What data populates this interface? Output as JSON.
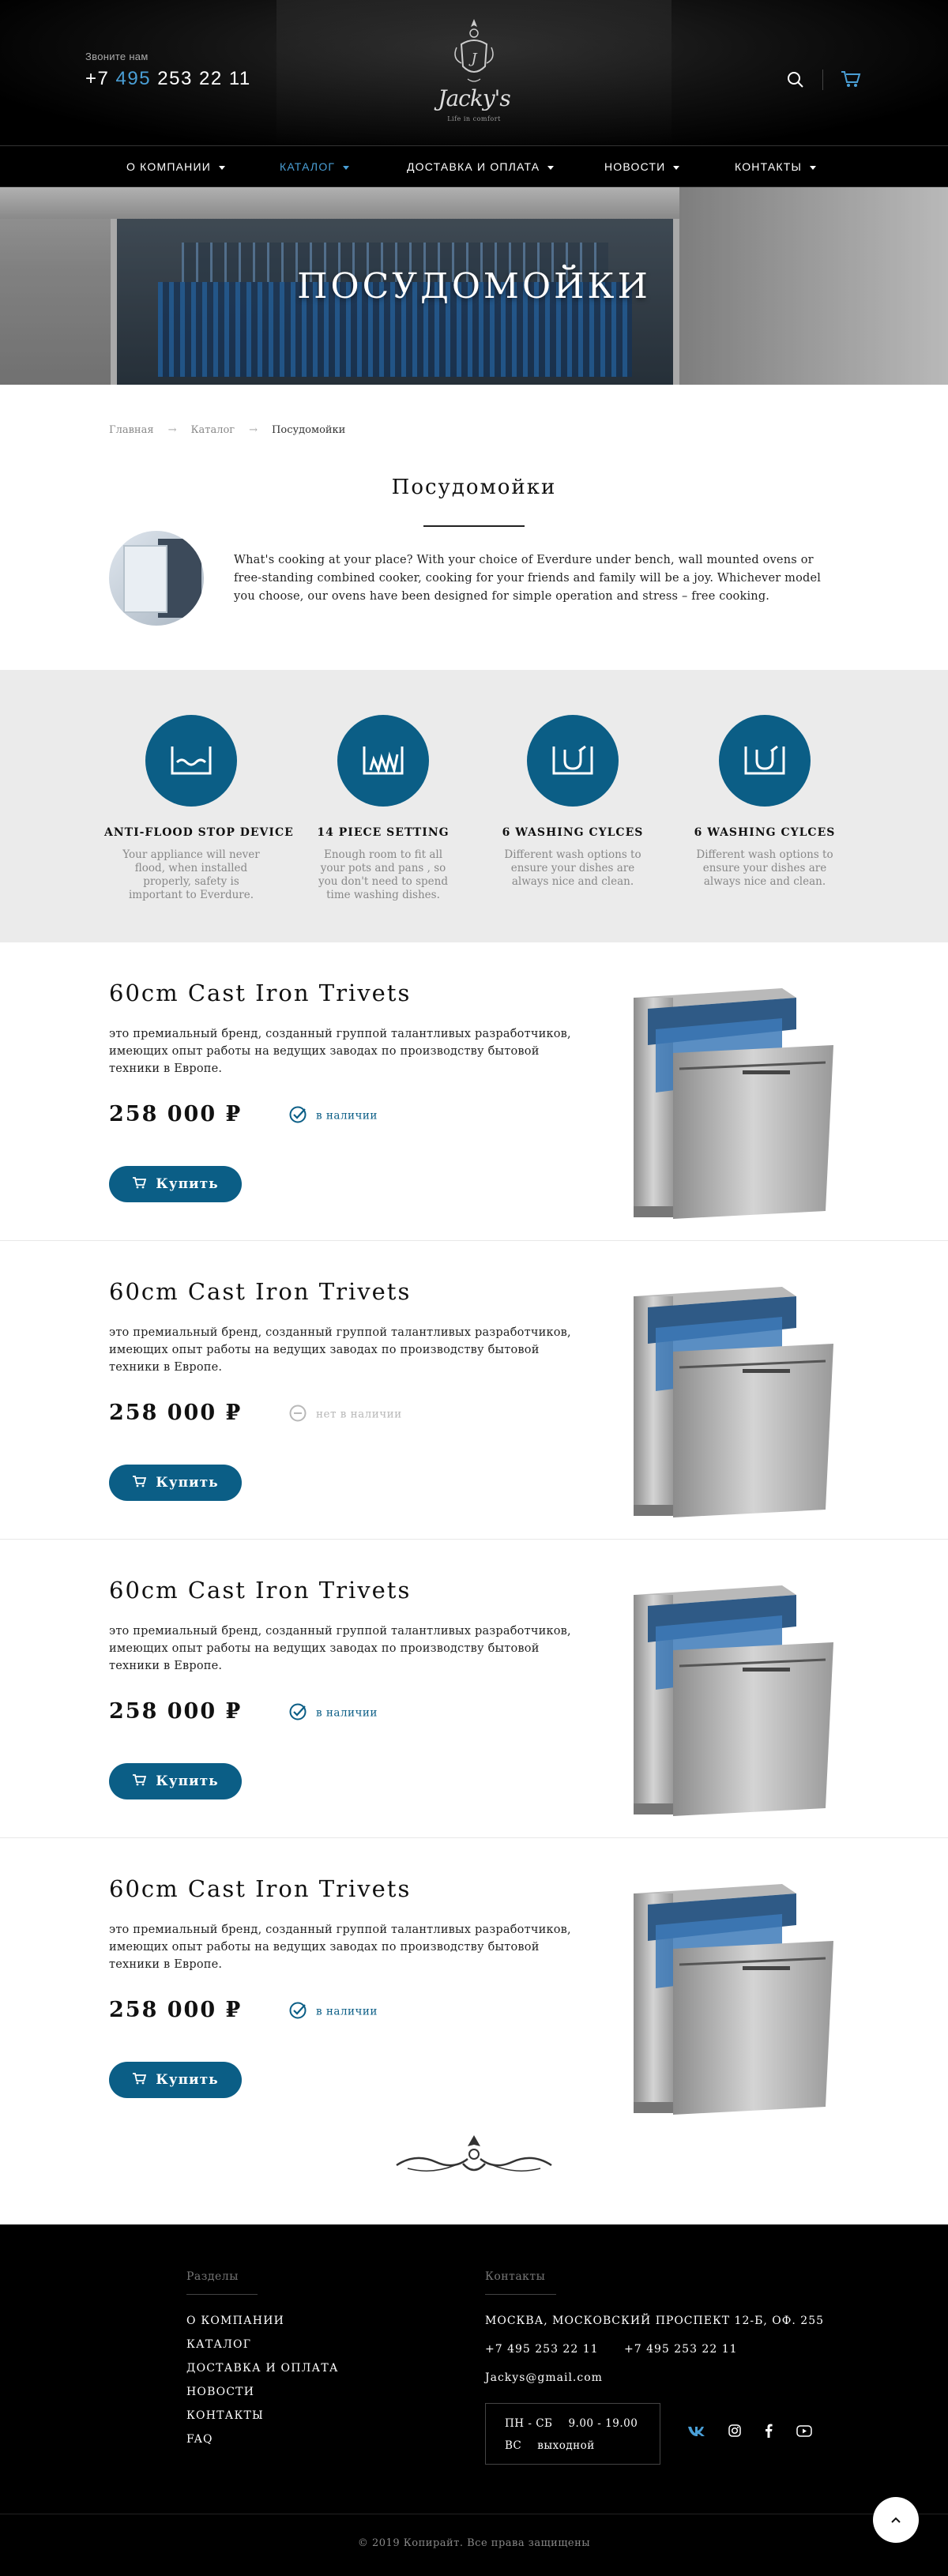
{
  "header": {
    "call_label": "Звоните нам",
    "phone_prefix": "+7",
    "phone_code": "495",
    "phone_number": "253 22 11",
    "logo_brand": "Jacky's",
    "logo_tag": "Life in comfort"
  },
  "nav": [
    {
      "label": "О КОМПАНИИ",
      "active": false
    },
    {
      "label": "КАТАЛОГ",
      "active": true
    },
    {
      "label": "ДОСТАВКА И ОПЛАТА",
      "active": false
    },
    {
      "label": "НОВОСТИ",
      "active": false
    },
    {
      "label": "КОНТАКТЫ",
      "active": false
    }
  ],
  "hero": {
    "title": "ПОСУДОМОЙКИ"
  },
  "breadcrumb": {
    "home": "Главная",
    "catalog": "Каталог",
    "current": "Посудомойки",
    "sep": "→"
  },
  "page": {
    "title": "Посудомойки",
    "intro": "What's cooking at your place? With your choice of Everdure under bench, wall mounted ovens or free-standing combined cooker, cooking for your friends and family will be a joy. Whichever model you choose, our ovens have been designed for simple operation and stress – free cooking."
  },
  "features": [
    {
      "icon": "flood-stop-icon",
      "title": "ANTI-FLOOD STOP DEVICE",
      "desc": "Your appliance will never flood, when installed properly, safety is important to Everdure."
    },
    {
      "icon": "piece-setting-icon",
      "title": "14 PIECE SETTING",
      "desc": "Enough room to fit all your pots and pans , so you don't need to spend time washing dishes."
    },
    {
      "icon": "washing-cycle-icon",
      "title": "6 WASHING CYLCES",
      "desc": "Different wash options to ensure your dishes are always nice and clean."
    },
    {
      "icon": "washing-cycle-icon",
      "title": "6 WASHING CYLCES",
      "desc": "Different wash options to ensure your dishes are always nice and clean."
    }
  ],
  "products": [
    {
      "name": "60cm Cast Iron Trivets",
      "desc": "это премиальный бренд, созданный группой талантливых разработчиков, имеющих опыт работы на ведущих заводах по производству бытовой техники в Европе.",
      "price": "258 000",
      "currency": "₽",
      "stock": "в наличии",
      "in_stock": true,
      "buy": "Купить"
    },
    {
      "name": "60cm Cast Iron Trivets",
      "desc": "это премиальный бренд, созданный группой талантливых разработчиков, имеющих опыт работы на ведущих заводах по производству бытовой техники в Европе.",
      "price": "258 000",
      "currency": "₽",
      "stock": "нет в наличии",
      "in_stock": false,
      "buy": "Купить"
    },
    {
      "name": "60cm Cast Iron Trivets",
      "desc": "это премиальный бренд, созданный группой талантливых разработчиков, имеющих опыт работы на ведущих заводах по производству бытовой техники в Европе.",
      "price": "258 000",
      "currency": "₽",
      "stock": "в наличии",
      "in_stock": true,
      "buy": "Купить"
    },
    {
      "name": "60cm Cast Iron Trivets",
      "desc": "это премиальный бренд, созданный группой талантливых разработчиков, имеющих опыт работы на ведущих заводах по производству бытовой техники в Европе.",
      "price": "258 000",
      "currency": "₽",
      "stock": "в наличии",
      "in_stock": true,
      "buy": "Купить"
    }
  ],
  "footer": {
    "sections_title": "Разделы",
    "links": [
      "О КОМПАНИИ",
      "КАТАЛОГ",
      "ДОСТАВКА И ОПЛАТА",
      "НОВОСТИ",
      "КОНТАКТЫ",
      "FAQ"
    ],
    "contacts_title": "Контакты",
    "address": "МОСКВА, МОСКОВСКИЙ ПРОСПЕКТ 12-Б, ОФ. 255",
    "phone1": "+7 495 253 22 11",
    "phone2": "+7 495 253 22 11",
    "email": "Jackys@gmail.com",
    "hours": [
      {
        "days": "ПН - СБ",
        "time": "9.00 - 19.00"
      },
      {
        "days": "ВС",
        "time": "выходной"
      }
    ],
    "social": [
      "vk-icon",
      "instagram-icon",
      "facebook-icon",
      "youtube-icon"
    ],
    "copyright": "© 2019 Копирайт. Все права защищены"
  },
  "colors": {
    "accent": "#0b5e86",
    "link_blue": "#4a9fd6",
    "footer_bg": "#000000",
    "features_bg": "#ebebeb"
  }
}
